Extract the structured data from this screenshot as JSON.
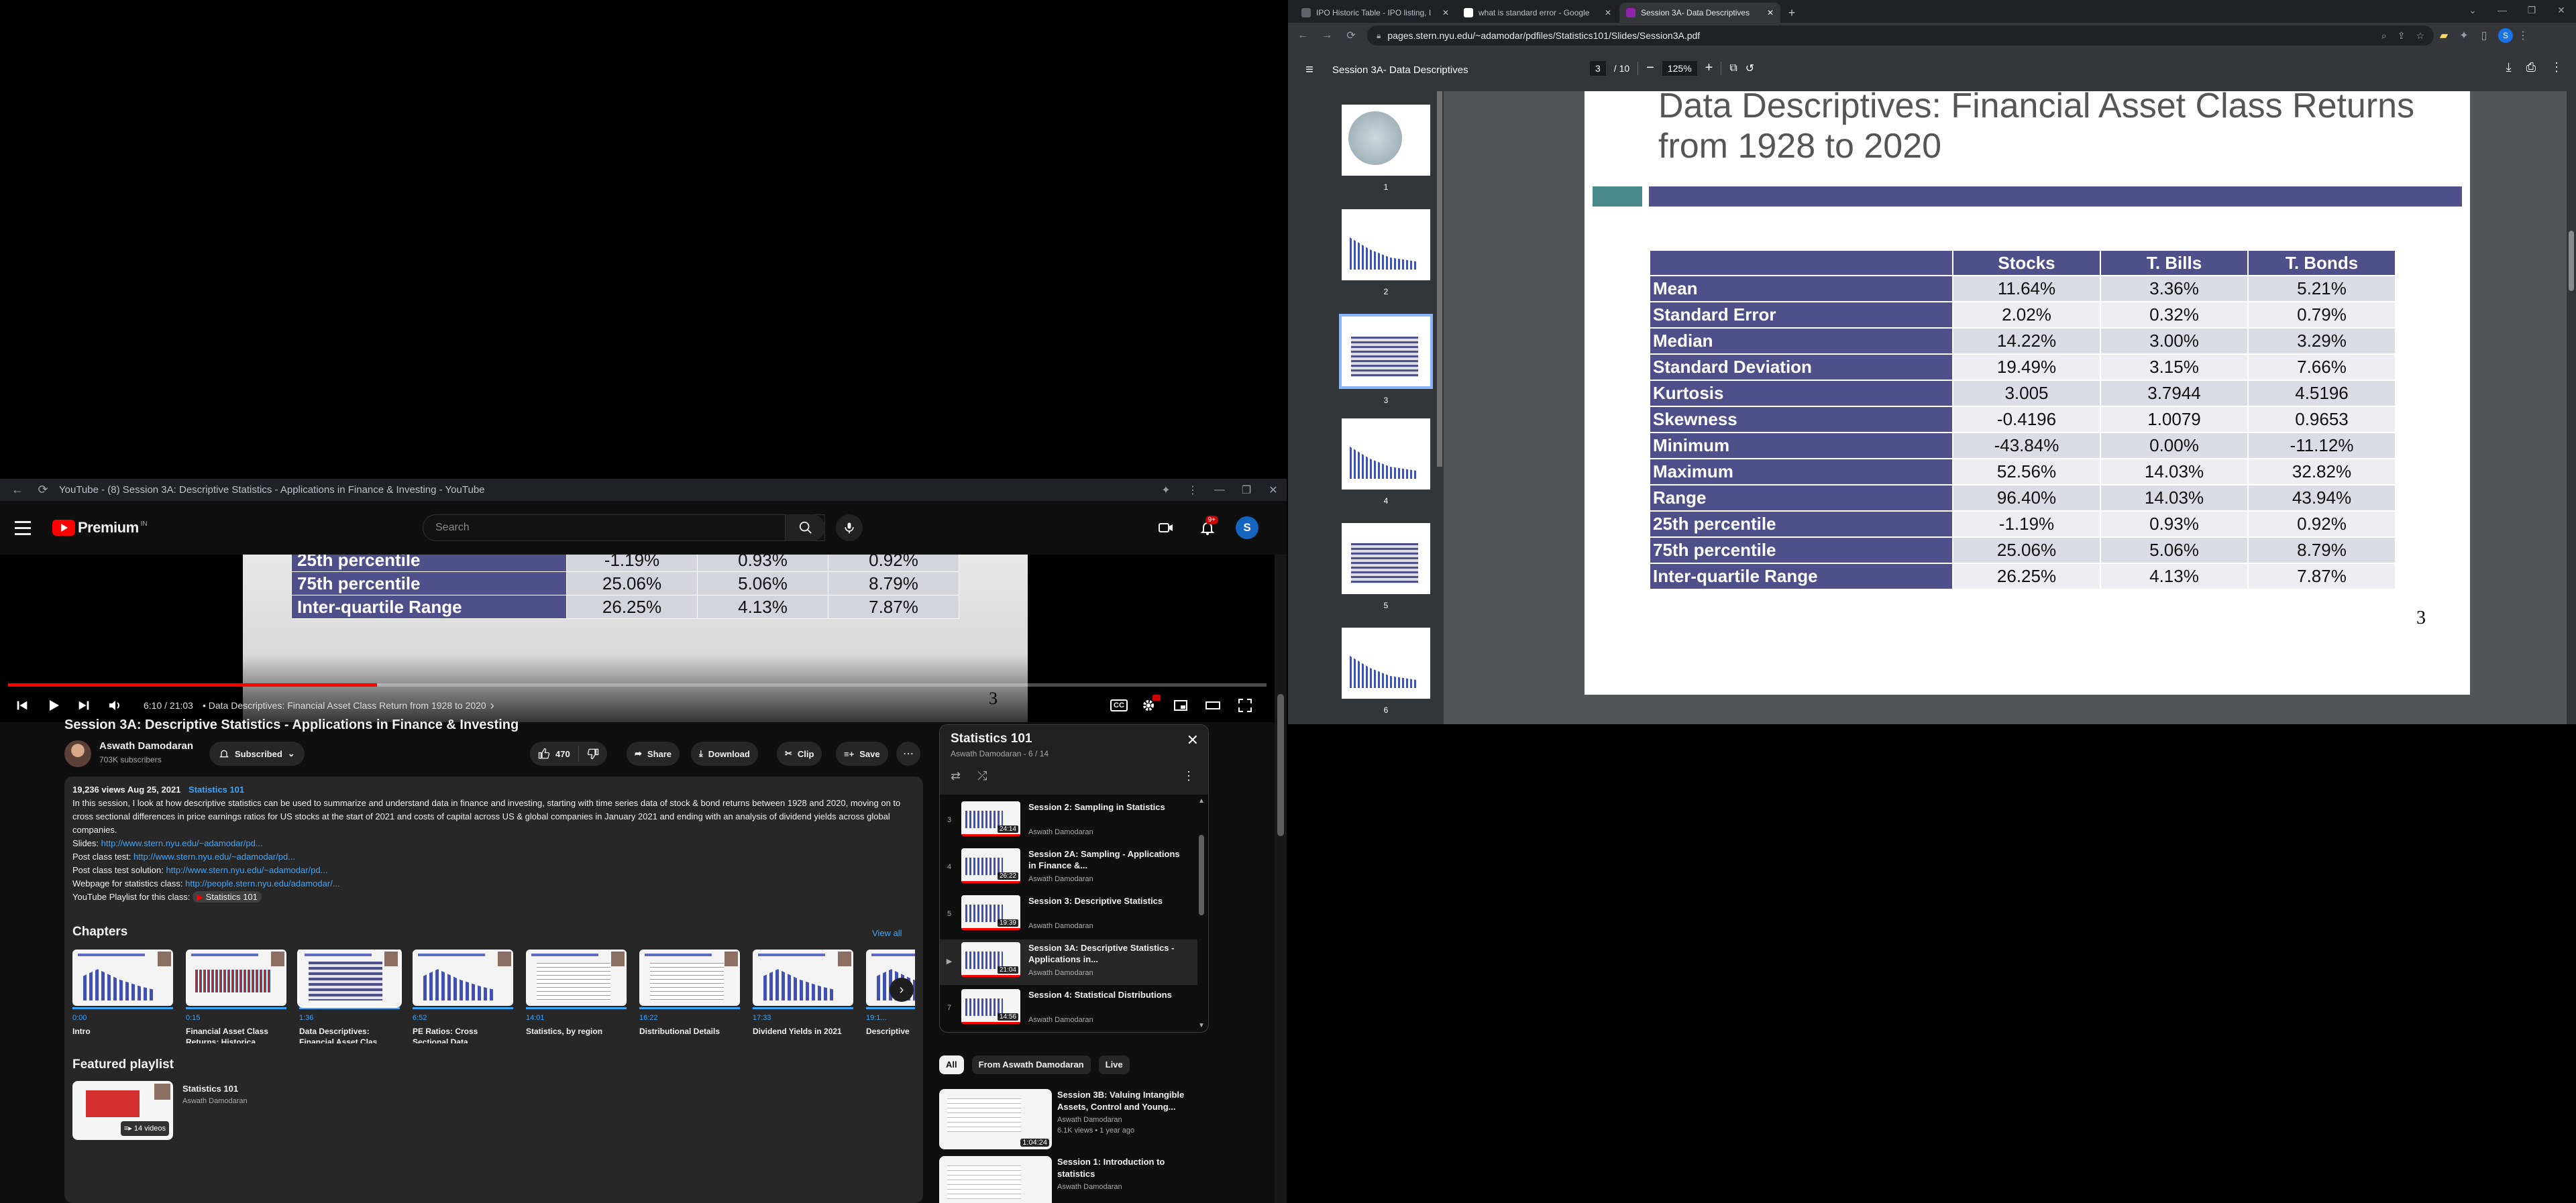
{
  "youtube": {
    "window_title": "YouTube - (8) Session 3A: Descriptive Statistics - Applications in Finance & Investing - YouTube",
    "brand": "Premium",
    "brand_sup": "IN",
    "search_placeholder": "Search",
    "notif_count": "9+",
    "avatar_letter": "S",
    "player": {
      "rows": [
        {
          "label": "25th percentile",
          "stocks": "-1.19%",
          "tbills": "0.93%",
          "tbonds": "0.92%"
        },
        {
          "label": "75th percentile",
          "stocks": "25.06%",
          "tbills": "5.06%",
          "tbonds": "8.79%"
        },
        {
          "label": "Inter-quartile Range",
          "stocks": "26.25%",
          "tbills": "4.13%",
          "tbonds": "7.87%"
        }
      ],
      "slide_number": "3",
      "time": "6:10 / 21:03",
      "chapter": "• Data Descriptives: Financial Asset Class Return from 1928 to 2020",
      "chapter_arrow": "›",
      "progress_fraction": 0.293,
      "cc": "CC"
    },
    "video": {
      "title": "Session 3A: Descriptive Statistics - Applications in Finance & Investing",
      "channel": "Aswath Damodaran",
      "subscribers": "703K subscribers",
      "subscribed": "Subscribed",
      "likes": "470",
      "share": "Share",
      "download": "Download",
      "clip": "Clip",
      "save": "Save"
    },
    "description": {
      "meta": "19,236 views  Aug 25, 2021",
      "hashtag": "Statistics 101",
      "body": "In this session, I look at how descriptive statistics can be used to summarize and understand data in finance and investing, starting with time series data of stock & bond  returns between 1928 and 2020, moving on to cross sectional differences in price earnings ratios for US stocks at the start of 2021 and costs of capital across US & global companies in January 2021 and ending with an analysis of dividend yields across global companies.",
      "links": [
        {
          "label": "Slides: ",
          "url": "http://www.stern.nyu.edu/~adamodar/pd..."
        },
        {
          "label": "Post class test: ",
          "url": "http://www.stern.nyu.edu/~adamodar/pd..."
        },
        {
          "label": "Post class test solution: ",
          "url": "http://www.stern.nyu.edu/~adamodar/pd..."
        },
        {
          "label": "Webpage for statistics class: ",
          "url": "http://people.stern.nyu.edu/adamodar/..."
        }
      ],
      "playlist_label": "YouTube Playlist for this class: ",
      "playlist_chip": "Statistics 101"
    },
    "chapters": {
      "heading": "Chapters",
      "view_all": "View all",
      "items": [
        {
          "time": "0:00",
          "title": "Intro"
        },
        {
          "time": "0:15",
          "title": "Financial Asset Class Returns: Historica..."
        },
        {
          "time": "1:36",
          "title": "Data Descriptives: Financial Asset Clas..."
        },
        {
          "time": "6:52",
          "title": "PE Ratios: Cross Sectional Data"
        },
        {
          "time": "14:01",
          "title": "Statistics, by region"
        },
        {
          "time": "16:22",
          "title": "Distributional Details"
        },
        {
          "time": "17:33",
          "title": "Dividend Yields in 2021"
        },
        {
          "time": "19:1...",
          "title": "Descriptive"
        }
      ]
    },
    "featured": {
      "heading": "Featured playlist",
      "title": "Statistics 101",
      "channel": "Aswath Damodaran",
      "count": "14 videos"
    },
    "playlist": {
      "title": "Statistics 101",
      "sub": "Aswath Damodaran - 6 / 14",
      "items": [
        {
          "index": "3",
          "title": "Session 2: Sampling in Statistics",
          "channel": "Aswath Damodaran",
          "duration": "24:14"
        },
        {
          "index": "4",
          "title": "Session 2A: Sampling - Applications in Finance &...",
          "channel": "Aswath Damodaran",
          "duration": "26:22"
        },
        {
          "index": "5",
          "title": "Session 3: Descriptive Statistics",
          "channel": "Aswath Damodaran",
          "duration": "19:39"
        },
        {
          "index": "▶",
          "title": "Session 3A: Descriptive Statistics - Applications in...",
          "channel": "Aswath Damodaran",
          "duration": "21:04"
        },
        {
          "index": "7",
          "title": "Session 4: Statistical Distributions",
          "channel": "Aswath Damodaran",
          "duration": "14:56"
        }
      ]
    },
    "filters": [
      "All",
      "From Aswath Damodaran",
      "Live"
    ],
    "recs": [
      {
        "title": "Session 3B: Valuing Intangible Assets, Control and Young...",
        "channel": "Aswath Damodaran",
        "meta": "6.1K views  •  1 year ago",
        "duration": "1:04:24"
      },
      {
        "title": "Session 1: Introduction to statistics",
        "channel": "Aswath Damodaran",
        "meta": "",
        "duration": ""
      }
    ]
  },
  "chrome": {
    "tabs": [
      {
        "title": "IPO Historic Table - IPO listing, I"
      },
      {
        "title": "what is standard error - Google"
      },
      {
        "title": "Session 3A- Data Descriptives"
      }
    ],
    "new_tab": "+",
    "url": "pages.stern.nyu.edu/~adamodar/pdfiles/Statistics101/Slides/Session3A.pdf"
  },
  "pdf": {
    "title": "Session 3A- Data Descriptives",
    "page_current": "3",
    "page_total": "/ 10",
    "zoom": "125%",
    "thumbnails": [
      "1",
      "2",
      "3",
      "4",
      "5",
      "6"
    ],
    "slide": {
      "title_line1": "Data Descriptives: Financial Asset Class Returns",
      "title_line2": "from 1928 to 2020",
      "slide_number": "3"
    }
  },
  "chart_data": {
    "type": "table",
    "columns": [
      "",
      "Stocks",
      "T. Bills",
      "T. Bonds"
    ],
    "rows": [
      [
        "Mean",
        "11.64%",
        "3.36%",
        "5.21%"
      ],
      [
        "Standard Error",
        "2.02%",
        "0.32%",
        "0.79%"
      ],
      [
        "Median",
        "14.22%",
        "3.00%",
        "3.29%"
      ],
      [
        "Standard Deviation",
        "19.49%",
        "3.15%",
        "7.66%"
      ],
      [
        "Kurtosis",
        "3.005",
        "3.7944",
        "4.5196"
      ],
      [
        "Skewness",
        "-0.4196",
        "1.0079",
        "0.9653"
      ],
      [
        "Minimum",
        "-43.84%",
        "0.00%",
        "-11.12%"
      ],
      [
        "Maximum",
        "52.56%",
        "14.03%",
        "32.82%"
      ],
      [
        "Range",
        "96.40%",
        "14.03%",
        "43.94%"
      ],
      [
        "25th percentile",
        "-1.19%",
        "0.93%",
        "0.92%"
      ],
      [
        "75th percentile",
        "25.06%",
        "5.06%",
        "8.79%"
      ],
      [
        "Inter-quartile Range",
        "26.25%",
        "4.13%",
        "7.87%"
      ]
    ]
  }
}
